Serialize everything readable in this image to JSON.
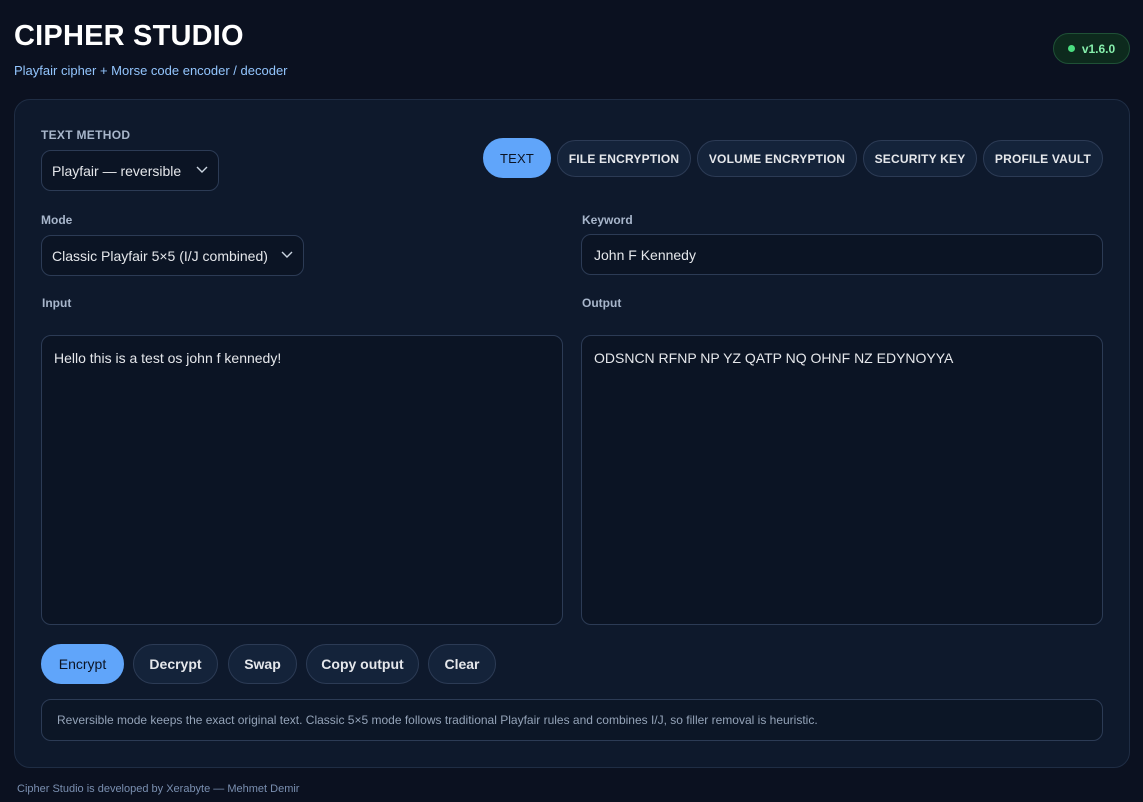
{
  "header": {
    "title": "CIPHER STUDIO",
    "subtitle": "Playfair cipher + Morse code encoder / decoder",
    "version": "v1.6.0"
  },
  "text_method": {
    "label": "TEXT METHOD",
    "selected": "Playfair — reversible"
  },
  "tabs": [
    {
      "label": "TEXT",
      "active": true
    },
    {
      "label": "FILE ENCRYPTION",
      "active": false
    },
    {
      "label": "VOLUME ENCRYPTION",
      "active": false
    },
    {
      "label": "SECURITY KEY",
      "active": false
    },
    {
      "label": "PROFILE VAULT",
      "active": false
    }
  ],
  "mode": {
    "label": "Mode",
    "selected": "Classic Playfair 5×5 (I/J combined)"
  },
  "keyword": {
    "label": "Keyword",
    "value": "John F Kennedy"
  },
  "input": {
    "label": "Input",
    "value": "Hello this is a test os john f kennedy!"
  },
  "output": {
    "label": "Output",
    "value": "ODSNCN RFNP NP YZ QATP NQ OHNF NZ EDYNOYYA"
  },
  "actions": {
    "encrypt": "Encrypt",
    "decrypt": "Decrypt",
    "swap": "Swap",
    "copy_output": "Copy output",
    "clear": "Clear"
  },
  "note": "Reversible mode keeps the exact original text. Classic 5×5 mode follows traditional Playfair rules and combines I/J, so filler removal is heuristic.",
  "footer": "Cipher Studio is developed by Xerabyte — Mehmet Demir",
  "colors": {
    "background": "#0b1120",
    "panel": "#0e192c",
    "accent": "#60a5fa",
    "badge_green": "#4ade80"
  },
  "icons": {
    "select_arrow": "chevron-down-icon",
    "status": "status-dot-icon"
  }
}
